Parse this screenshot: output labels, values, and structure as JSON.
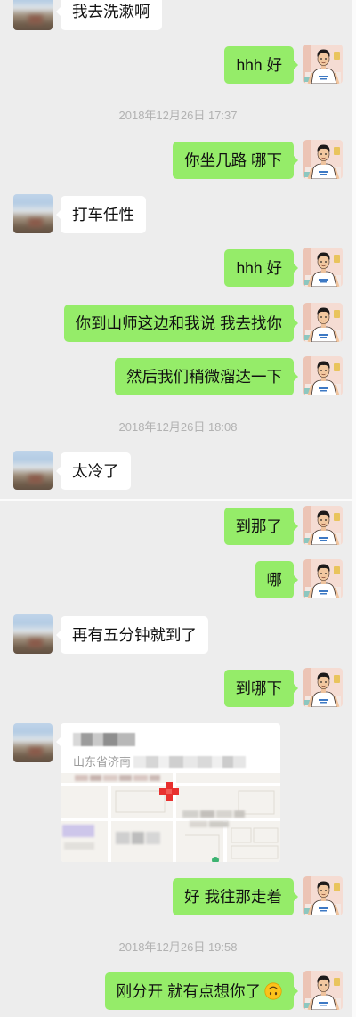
{
  "theme": {
    "background": "#ededed",
    "outgoing_bubble": "#95ec69",
    "incoming_bubble": "#ffffff",
    "timestamp_text": "#b2b2b2",
    "map_pin": "#e8302e"
  },
  "avatars": {
    "self": "cartoon-man-avatar-icon",
    "contact": "blurred-photo-avatar-icon"
  },
  "messages": [
    {
      "incoming": "我去洗漱啊"
    },
    {
      "outgoing": "hhh 好"
    },
    {
      "timestamp": "2018年12月26日 17:37"
    },
    {
      "outgoing": "你坐几路 哪下"
    },
    {
      "incoming": "打车任性"
    },
    {
      "outgoing": "hhh 好"
    },
    {
      "outgoing": "你到山师这边和我说 我去找你"
    },
    {
      "outgoing": "然后我们稍微溜达一下"
    },
    {
      "timestamp": "2018年12月26日 18:08"
    },
    {
      "incoming": "太冷了"
    },
    {
      "outgoing": "到那了"
    },
    {
      "outgoing": "哪"
    },
    {
      "incoming": "再有五分钟就到了"
    },
    {
      "outgoing": "到哪下"
    },
    {
      "incoming_location": {
        "address": "山东省济南",
        "pin_icon": "map-pin-icon"
      }
    },
    {
      "outgoing": "好 我往那走着"
    },
    {
      "timestamp": "2018年12月26日 19:58"
    },
    {
      "outgoing": "刚分开 就有点想你了",
      "emoji": "upside-down-face-icon"
    }
  ]
}
